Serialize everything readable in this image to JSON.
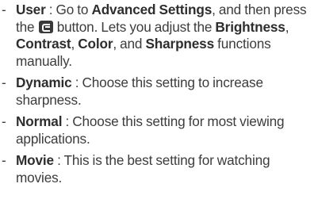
{
  "items": [
    {
      "dash": "-",
      "term": "User",
      "sep": " : ",
      "t1": "Go to ",
      "b1": "Advanced Settings",
      "t2": ", and then press the ",
      "icon": "picture-mode-button-icon",
      "t3": " button. Lets you adjust the ",
      "b2": "Brightness",
      "t4": ", ",
      "b3": "Contrast",
      "t5": ", ",
      "b4": "Color",
      "t6": ", and ",
      "b5": "Sharpness",
      "t7": " functions manually."
    },
    {
      "dash": "-",
      "term": "Dynamic",
      "sep": " : ",
      "text": "Choose this setting to increase sharpness."
    },
    {
      "dash": "-",
      "term": "Normal",
      "sep": " : ",
      "text": "Choose this setting for most viewing applications."
    },
    {
      "dash": "-",
      "term": "Movie",
      "sep": " : ",
      "text": "This is the best setting for watching movies."
    }
  ]
}
